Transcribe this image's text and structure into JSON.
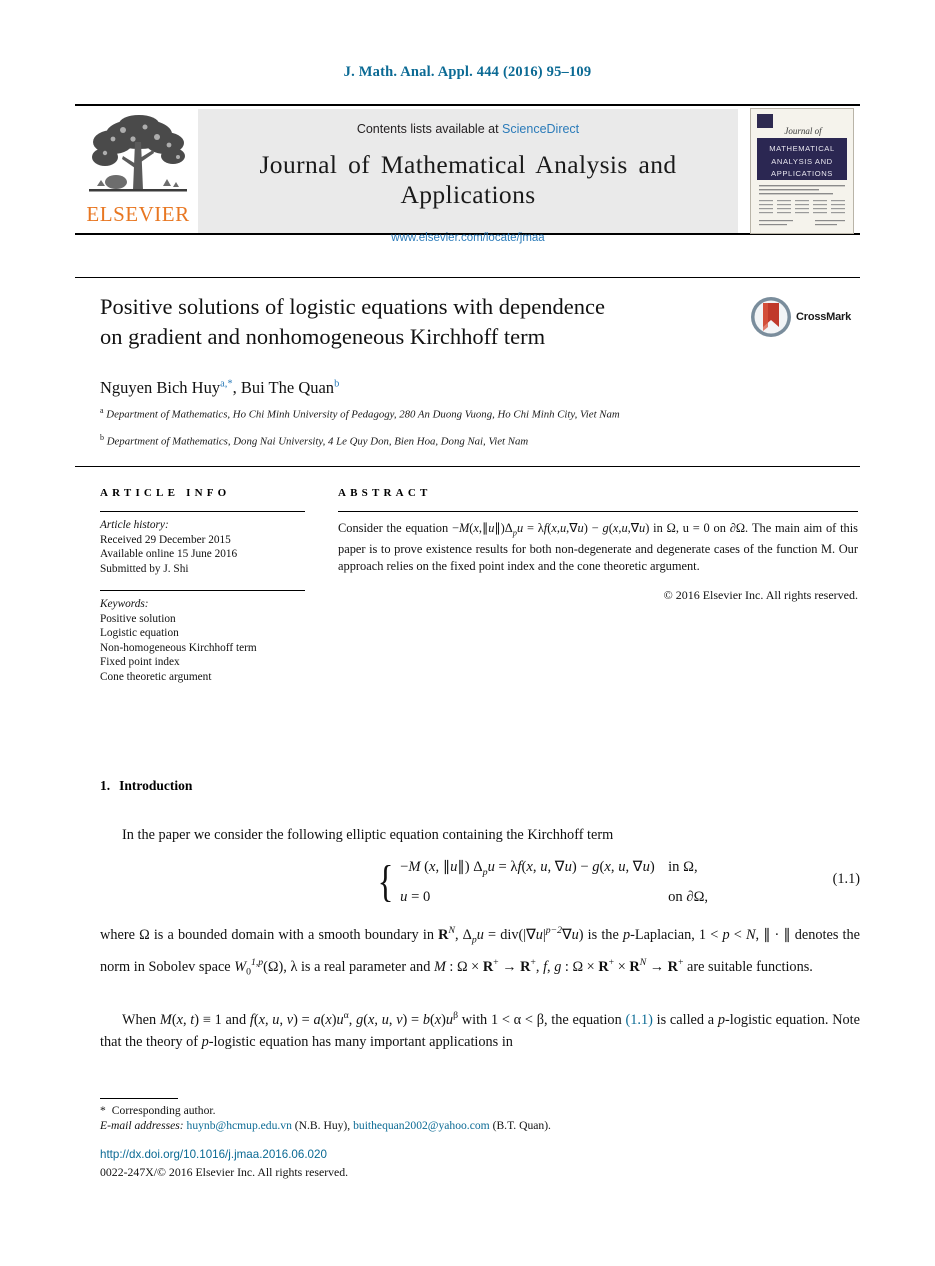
{
  "running_head": "J. Math. Anal. Appl. 444 (2016) 95–109",
  "masthead": {
    "contents_prefix": "Contents lists available at",
    "sciencedirect": "ScienceDirect",
    "journal_name": "Journal of Mathematical Analysis and Applications",
    "journal_url": "www.elsevier.com/locate/jmaa",
    "publisher": "ELSEVIER",
    "cover": {
      "top_label": "Journal of",
      "band_line1": "MATHEMATICAL",
      "band_line2": "ANALYSIS AND",
      "band_line3": "APPLICATIONS"
    }
  },
  "article": {
    "title_line1": "Positive solutions of logistic equations with dependence",
    "title_line2": "on gradient and nonhomogeneous Kirchhoff term",
    "crossmark_label": "CrossMark",
    "authors": [
      {
        "name": "Nguyen Bich Huy",
        "marks": "a,*"
      },
      {
        "name": "Bui The Quan",
        "marks": "b"
      }
    ],
    "affiliations": [
      {
        "mark": "a",
        "text": "Department of Mathematics, Ho Chi Minh University of Pedagogy, 280 An Duong Vuong, Ho Chi Minh City, Viet Nam"
      },
      {
        "mark": "b",
        "text": "Department of Mathematics, Dong Nai University, 4 Le Quy Don, Bien Hoa, Dong Nai, Viet Nam"
      }
    ]
  },
  "info": {
    "heading": "ARTICLE INFO",
    "history_label": "Article history:",
    "history": [
      "Received 29 December 2015",
      "Available online 15 June 2016",
      "Submitted by J. Shi"
    ],
    "keywords_label": "Keywords:",
    "keywords": [
      "Positive solution",
      "Logistic equation",
      "Non-homogeneous Kirchhoff term",
      "Fixed point index",
      "Cone theoretic argument"
    ]
  },
  "abstract": {
    "heading": "ABSTRACT",
    "text_parts": {
      "p1": "Consider the equation ",
      "p2": " in Ω, u = 0 on ∂Ω. The main aim of this paper is to prove existence results for both non-degenerate and degenerate cases of the function M. Our approach relies on the fixed point index and the cone theoretic argument.",
      "equation": "−M(x,‖u‖)Δ_p u = λf(x,u,∇u) − g(x,u,∇u)"
    },
    "copyright": "© 2016 Elsevier Inc. All rights reserved."
  },
  "body": {
    "section_number": "1.",
    "section_title": "Introduction",
    "paragraph_intro": "In the paper we consider the following elliptic equation containing the Kirchhoff term",
    "equation": {
      "row1_lhs": "−M (x, ‖u‖) Δ_p u = λf(x, u, ∇u) − g(x, u, ∇u)",
      "row1_rhs": "in Ω,",
      "row2_lhs": "u = 0",
      "row2_rhs": "on ∂Ω,",
      "number": "(1.1)"
    },
    "paragraph_where": "where Ω is a bounded domain with a smooth boundary in R^N, Δ_p u = div(|∇u|^{p−2}∇u) is the p-Laplacian, 1 < p < N, ‖ · ‖ denotes the norm in Sobolev space W_0^{1,p}(Ω), λ is a real parameter and M : Ω × R+ → R+, f, g : Ω × R+ × R^N → R+ are suitable functions.",
    "paragraph_when": "When M(x,t) ≡ 1 and f(x,u,v) = a(x)u^α, g(x,u,v) = b(x)u^β with 1 < α < β, the equation (1.1) is called a p-logistic equation. Note that the theory of p-logistic equation has many important applications in",
    "equation_ref": "(1.1)"
  },
  "footer": {
    "corresponding": "Corresponding author.",
    "email_label": "E-mail addresses:",
    "email1": "huynb@hcmup.edu.vn",
    "email1_owner": "(N.B. Huy),",
    "email2": "buithequan2002@yahoo.com",
    "email2_owner": "(B.T. Quan).",
    "doi": "http://dx.doi.org/10.1016/j.jmaa.2016.06.020",
    "issn": "0022-247X/© 2016 Elsevier Inc. All rights reserved."
  },
  "colors": {
    "link_blue": "#2b7bb9",
    "head_blue": "#0b6a94",
    "elsevier_orange": "#e87722",
    "band_gray": "#eaeaea"
  }
}
